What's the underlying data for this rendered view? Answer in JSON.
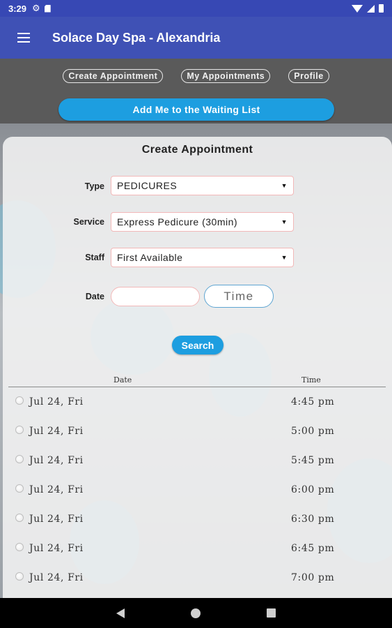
{
  "status_bar": {
    "time": "3:29",
    "icons": [
      "gear-icon",
      "sd-card-icon",
      "wifi-icon",
      "cell-signal-icon",
      "battery-icon"
    ]
  },
  "app_bar": {
    "title": "Solace Day Spa - Alexandria",
    "menu_icon": "hamburger-menu-icon"
  },
  "nav": {
    "create_appointment": "Create Appointment",
    "my_appointments": "My Appointments",
    "profile": "Profile",
    "waiting_list": "Add Me to the Waiting List"
  },
  "form": {
    "title": "Create Appointment",
    "type_label": "Type",
    "type_value": "PEDICURES",
    "service_label": "Service",
    "service_value": "Express Pedicure (30min)",
    "staff_label": "Staff",
    "staff_value": "First Available",
    "date_label": "Date",
    "date_value": "",
    "time_button": "Time",
    "search_button": "Search"
  },
  "table": {
    "headers": {
      "date": "Date",
      "time": "Time"
    },
    "rows": [
      {
        "date": "Jul 24, Fri",
        "time": "4:45 pm"
      },
      {
        "date": "Jul 24, Fri",
        "time": "5:00 pm"
      },
      {
        "date": "Jul 24, Fri",
        "time": "5:45 pm"
      },
      {
        "date": "Jul 24, Fri",
        "time": "6:00 pm"
      },
      {
        "date": "Jul 24, Fri",
        "time": "6:30 pm"
      },
      {
        "date": "Jul 24, Fri",
        "time": "6:45 pm"
      },
      {
        "date": "Jul 24, Fri",
        "time": "7:00 pm"
      }
    ]
  },
  "colors": {
    "app_bar": "#3f51b5",
    "status_bar": "#3748b4",
    "accent": "#1d9ee0"
  }
}
